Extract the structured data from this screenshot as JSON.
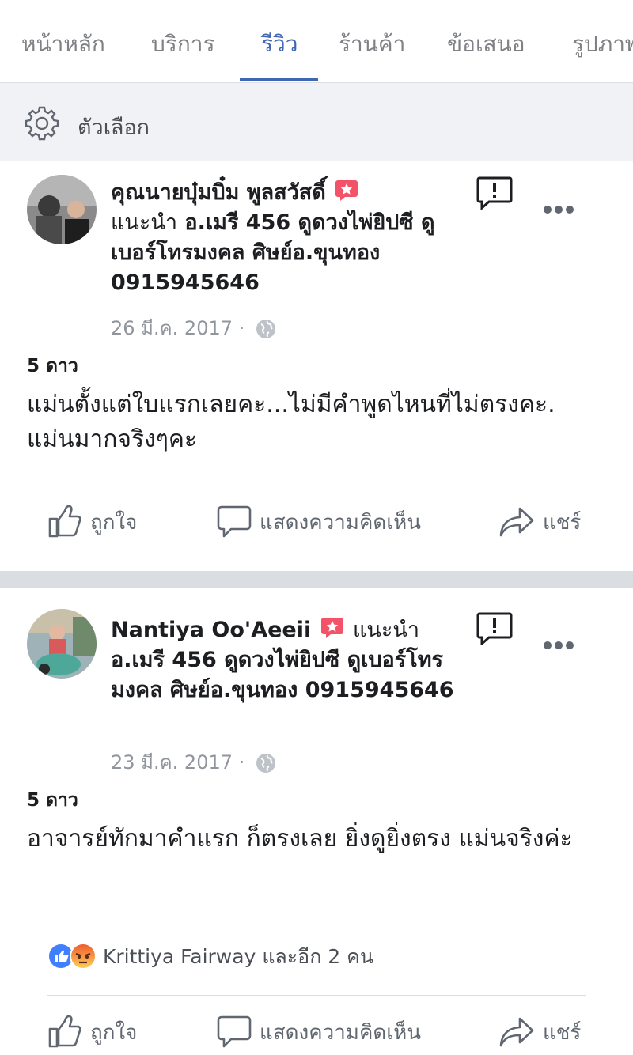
{
  "tabs": [
    {
      "label": "หน้าหลัก",
      "active": false
    },
    {
      "label": "บริการ",
      "active": false
    },
    {
      "label": "รีวิว",
      "active": true
    },
    {
      "label": "ร้านค้า",
      "active": false
    },
    {
      "label": "ข้อเสนอ",
      "active": false
    },
    {
      "label": "รูปภาพ",
      "active": false
    }
  ],
  "options": {
    "label": "ตัวเลือก",
    "icon": "gear-icon"
  },
  "reviews": [
    {
      "author": "คุณนายบุ๋มบิ๋ม พูลสวัสดิ์",
      "recommends": "แนะนำ",
      "page_name": "อ.เมรี 456 ดูดวงไพ่ยิปซี ดูเบอร์โทรมงคล ศิษย์อ.ขุนทอง 0915945646",
      "date": "26 มี.ค. 2017",
      "rating": "5 ดาว",
      "text": "แม่นตั้งแต่ใบแรกเลยคะ...ไม่มีคำพูดไหนที่ไม่ตรงคะ. แม่นมากจริงๆคะ",
      "reactions": null
    },
    {
      "author": "Nantiya Oo'Aeeii",
      "recommends": "แนะนำ",
      "page_name": "อ.เมรี 456 ดูดวงไพ่ยิปซี ดูเบอร์โทรมงคล ศิษย์อ.ขุนทอง 0915945646",
      "date": "23 มี.ค. 2017",
      "rating": "5 ดาว",
      "text": "อาจารย์ทักมาคำแรก ก็ตรงเลย ยิ่งดูยิ่งตรง แม่นจริงค่ะ",
      "reactions": {
        "summary": "Krittiya Fairway และอีก 2 คน",
        "types": [
          "like-icon",
          "angry-icon"
        ]
      }
    }
  ],
  "actions": {
    "like": "ถูกใจ",
    "comment": "แสดงความคิดเห็น",
    "share": "แชร์"
  },
  "colors": {
    "accent": "#4267b2",
    "badge": "#f35369",
    "muted": "#90949c",
    "options_bg": "#f1f2f5"
  }
}
